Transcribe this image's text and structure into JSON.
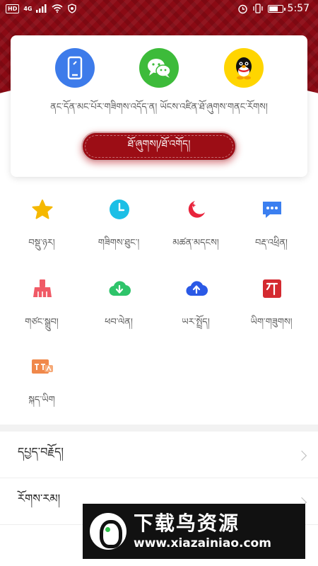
{
  "status_bar": {
    "hd": "HD",
    "network": "4G",
    "time": "5:57"
  },
  "login": {
    "icons": [
      "phone-icon",
      "wechat-icon",
      "qq-icon"
    ],
    "caption": "ནང་དོན་མང་པོར་གཟིགས་འདོད་ན། ཡོངས་འཛིན་ཐོ་ཞུགས་གནང་རོགས།",
    "button_label": "ཐོ་ཞུགས།/ཐོ་འགོད།"
  },
  "menu": [
    {
      "label": "བསྡུ་ཉར།",
      "icon": "star-icon",
      "color": "#f5b800"
    },
    {
      "label": "གཟིགས་ཐུང་།",
      "icon": "clock-icon",
      "color": "#1cbfe6"
    },
    {
      "label": "མཚན་མདངས།",
      "icon": "moon-icon",
      "color": "#e8243c"
    },
    {
      "label": "བརྡ་འཕྲིན།",
      "icon": "message-icon",
      "color": "#3b7ff0"
    },
    {
      "label": "གཙང་སྒྲུབ།",
      "icon": "broom-icon",
      "color": "#f05a66"
    },
    {
      "label": "ཕབ་ལེན།",
      "icon": "cloud-download-icon",
      "color": "#2ec46a"
    },
    {
      "label": "ཡར་སྤྲོད།",
      "icon": "cloud-upload-icon",
      "color": "#2a59e6"
    },
    {
      "label": "ཡིག་གཟུགས།",
      "icon": "font-icon",
      "color": "#d42a30"
    },
    {
      "label": "སྐད་ཡིག",
      "icon": "language-icon",
      "color": "#f0884a"
    }
  ],
  "list": [
    {
      "label": "དཔྱད་བརྗོད།"
    },
    {
      "label": "རོགས་རམ།"
    }
  ],
  "watermark": {
    "title": "下载鸟资源",
    "url": "www.xiazainiao.com"
  }
}
